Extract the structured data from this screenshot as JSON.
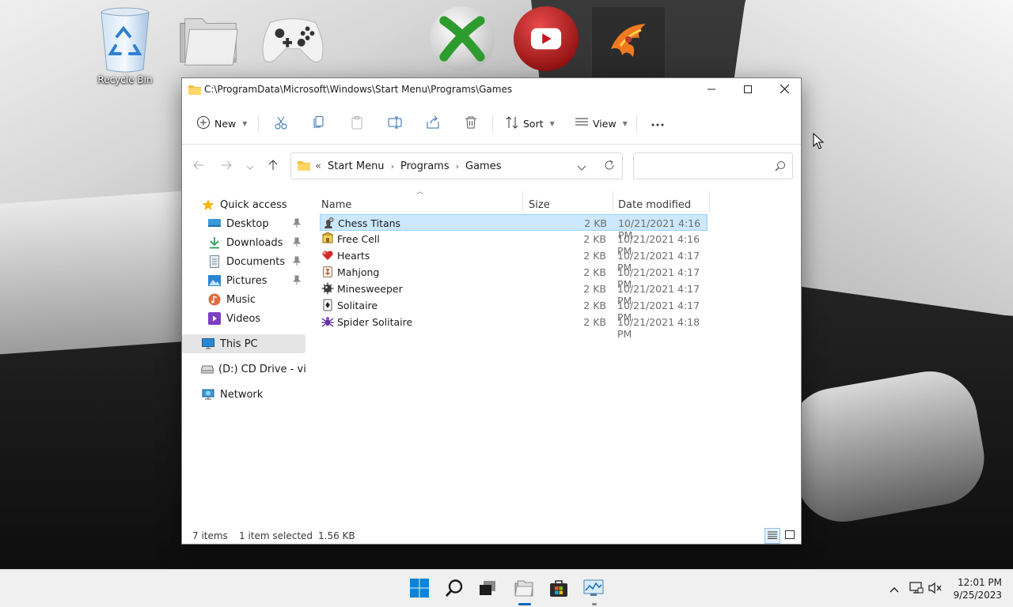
{
  "desktop": {
    "icons": [
      {
        "label": "Recycle Bin",
        "icon": "recycle-bin-icon"
      },
      {
        "label": "",
        "icon": "folders-icon"
      },
      {
        "label": "",
        "icon": "xbox-controller-icon"
      },
      {
        "label": "",
        "icon": "xbox-logo-icon"
      },
      {
        "label": "",
        "icon": "youtube-icon"
      },
      {
        "label": "",
        "icon": "phoenix-app-icon"
      }
    ]
  },
  "window": {
    "title": "C:\\ProgramData\\Microsoft\\Windows\\Start Menu\\Programs\\Games",
    "controls": {
      "minimize": "minimize-icon",
      "maximize": "maximize-icon",
      "close": "close-icon"
    }
  },
  "commandbar": {
    "new_label": "New",
    "sort_label": "Sort",
    "view_label": "View",
    "icons": [
      "cut-icon",
      "copy-icon",
      "paste-icon",
      "rename-icon",
      "share-icon",
      "delete-icon",
      "more-icon"
    ]
  },
  "navigation": {
    "breadcrumb_overflow": "«",
    "breadcrumbs": [
      "Start Menu",
      "Programs",
      "Games"
    ],
    "search_placeholder": ""
  },
  "sidebar": {
    "quick_access": "Quick access",
    "pinned": [
      {
        "label": "Desktop",
        "icon": "desktop-icon"
      },
      {
        "label": "Downloads",
        "icon": "downloads-icon"
      },
      {
        "label": "Documents",
        "icon": "documents-icon"
      },
      {
        "label": "Pictures",
        "icon": "pictures-icon"
      },
      {
        "label": "Music",
        "icon": "music-icon"
      },
      {
        "label": "Videos",
        "icon": "videos-icon"
      }
    ],
    "this_pc": "This PC",
    "cd_drive": "(D:) CD Drive - virti",
    "network": "Network"
  },
  "files": {
    "columns": {
      "name": "Name",
      "size": "Size",
      "date": "Date modified"
    },
    "rows": [
      {
        "name": "Chess Titans",
        "size": "2 KB",
        "date": "10/21/2021 4:16 PM",
        "icon": "chess-icon",
        "selected": true
      },
      {
        "name": "Free Cell",
        "size": "2 KB",
        "date": "10/21/2021 4:16 PM",
        "icon": "freecell-icon",
        "selected": false
      },
      {
        "name": "Hearts",
        "size": "2 KB",
        "date": "10/21/2021 4:17 PM",
        "icon": "hearts-icon",
        "selected": false
      },
      {
        "name": "Mahjong",
        "size": "2 KB",
        "date": "10/21/2021 4:17 PM",
        "icon": "mahjong-icon",
        "selected": false
      },
      {
        "name": "Minesweeper",
        "size": "2 KB",
        "date": "10/21/2021 4:17 PM",
        "icon": "minesweeper-icon",
        "selected": false
      },
      {
        "name": "Solitaire",
        "size": "2 KB",
        "date": "10/21/2021 4:17 PM",
        "icon": "solitaire-icon",
        "selected": false
      },
      {
        "name": "Spider Solitaire",
        "size": "2 KB",
        "date": "10/21/2021 4:18 PM",
        "icon": "spider-solitaire-icon",
        "selected": false
      }
    ]
  },
  "status": {
    "items": "7 items",
    "selection": "1 item selected",
    "size": "1.56 KB"
  },
  "taskbar": {
    "apps": [
      "start-icon",
      "search-icon",
      "task-view-icon",
      "file-explorer-icon",
      "store-icon",
      "resource-monitor-icon"
    ],
    "tray": [
      "chevron-up-icon",
      "network-icon",
      "volume-muted-icon"
    ],
    "time": "12:01 PM",
    "date": "9/25/2023"
  },
  "colors": {
    "accent": "#0067c0",
    "selection_bg": "#cce8ff",
    "selection_border": "#99d1ff"
  }
}
